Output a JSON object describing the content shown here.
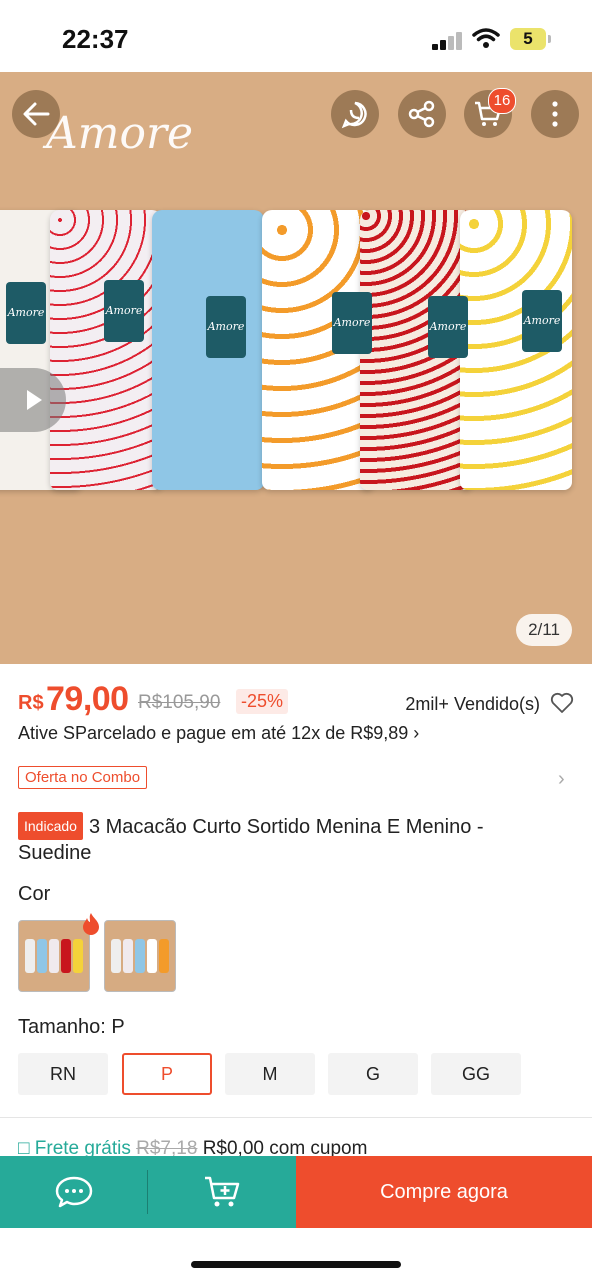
{
  "status_bar": {
    "time": "22:37",
    "battery": "5"
  },
  "hero": {
    "logo_text": "Amore",
    "cart_badge": "16",
    "page_indicator": "2/11"
  },
  "price": {
    "currency": "R$",
    "value": "79,00",
    "old": "R$105,90",
    "discount": "-25%",
    "sold": "2mil+ Vendido(s)"
  },
  "installment": "Ative SParcelado e pague em até 12x de R$9,89",
  "combo_label": "Oferta no Combo",
  "product": {
    "badge": "Indicado",
    "title": "3 Macacão Curto Sortido Menina E Menino - Suedine"
  },
  "color_label": "Cor",
  "size": {
    "label": "Tamanho: P",
    "options": [
      "RN",
      "P",
      "M",
      "G",
      "GG"
    ],
    "selected": "P"
  },
  "shipping": {
    "label": "Frete grátis",
    "old": "R$7,18",
    "new": "R$0,00 com cupom"
  },
  "bottom_bar": {
    "buy_label": "Compre agora"
  },
  "colors": {
    "accent": "#ee4d2d",
    "teal": "#26aa99",
    "hero_bg": "#d8ad84"
  }
}
